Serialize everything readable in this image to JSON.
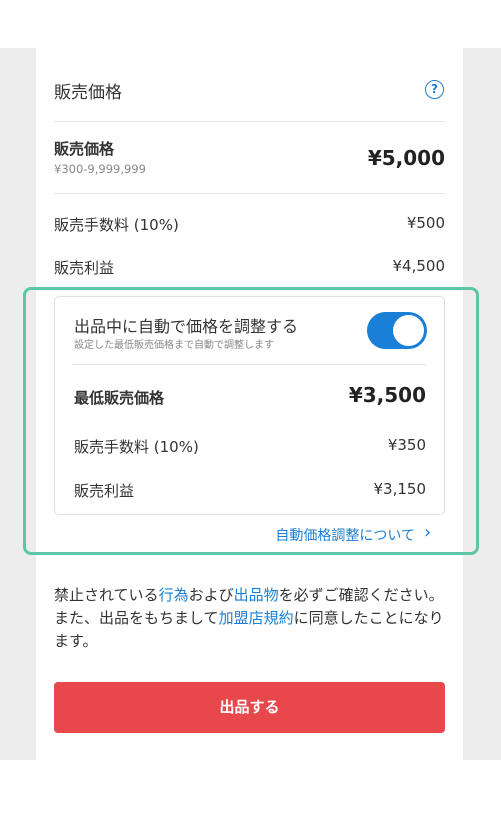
{
  "section": {
    "title": "販売価格"
  },
  "price": {
    "label": "販売価格",
    "range": "¥300-9,999,999",
    "value": "¥5,000"
  },
  "fee": {
    "label": "販売手数料 (10%)",
    "value": "¥500"
  },
  "profit": {
    "label": "販売利益",
    "value": "¥4,500"
  },
  "auto": {
    "title": "出品中に自動で価格を調整する",
    "subtitle": "設定した最低販売価格まで自動で調整します",
    "toggle_on": true,
    "min_label": "最低販売価格",
    "min_value": "¥3,500",
    "fee_label": "販売手数料 (10%)",
    "fee_value": "¥350",
    "profit_label": "販売利益",
    "profit_value": "¥3,150",
    "link": "自動価格調整について"
  },
  "notice": {
    "p1": "禁止されている",
    "link1": "行為",
    "p2": "および",
    "link2": "出品物",
    "p3": "を必ずご確認ください。また、出品をもちまして",
    "link3": "加盟店規約",
    "p4": "に同意したことになります。"
  },
  "submit": {
    "label": "出品する"
  },
  "colors": {
    "accent": "#1a7fd6",
    "submit": "#e8474c",
    "highlight_border": "#5cc6a6"
  }
}
